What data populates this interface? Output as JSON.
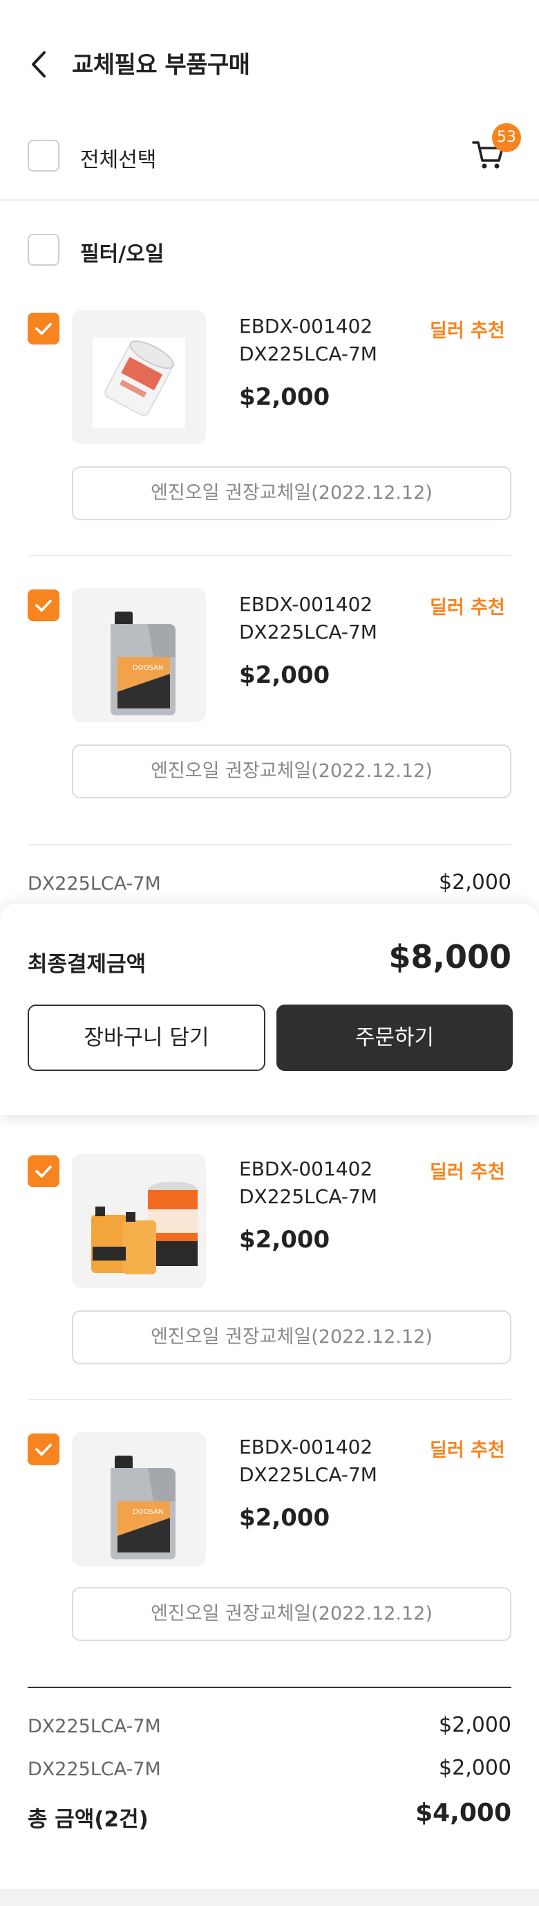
{
  "header": {
    "title": "교체필요 부품구매"
  },
  "select_all": {
    "label": "전체선택"
  },
  "cart": {
    "badge_count": "53"
  },
  "category": {
    "name": "필터/오일"
  },
  "products": [
    {
      "code": "EBDX-001402",
      "model": "DX225LCA-7M",
      "price": "$2,000",
      "tag": "딜러 추천",
      "recommend": "엔진오일 권장교체일(2022.12.12)",
      "image": "oil-filter-icon"
    },
    {
      "code": "EBDX-001402",
      "model": "DX225LCA-7M",
      "price": "$2,000",
      "tag": "딜러 추천",
      "recommend": "엔진오일 권장교체일(2022.12.12)",
      "image": "oil-jug-icon"
    },
    {
      "code": "EBDX-001402",
      "model": "DX225LCA-7M",
      "price": "$2,000",
      "tag": "딜러 추천",
      "recommend": "엔진오일 권장교체일(2022.12.12)",
      "image": "axle-oil-set-icon"
    },
    {
      "code": "EBDX-001402",
      "model": "DX225LCA-7M",
      "price": "$2,000",
      "tag": "딜러 추천",
      "recommend": "엔진오일 권장교체일(2022.12.12)",
      "image": "oil-jug-icon"
    }
  ],
  "partial_summary": {
    "model": "DX225LCA-7M",
    "price": "$2,000"
  },
  "checkout_panel": {
    "final_label": "최종결제금액",
    "final_amount": "$8,000",
    "add_to_cart_label": "장바구니 담기",
    "order_label": "주문하기"
  },
  "summary": {
    "rows": [
      {
        "model": "DX225LCA-7M",
        "price": "$2,000"
      },
      {
        "model": "DX225LCA-7M",
        "price": "$2,000"
      }
    ],
    "total_label": "총 금액(2건)",
    "total_amount": "$4,000"
  },
  "colors": {
    "accent": "#f7841e",
    "dark_button": "#2f2f2f"
  }
}
